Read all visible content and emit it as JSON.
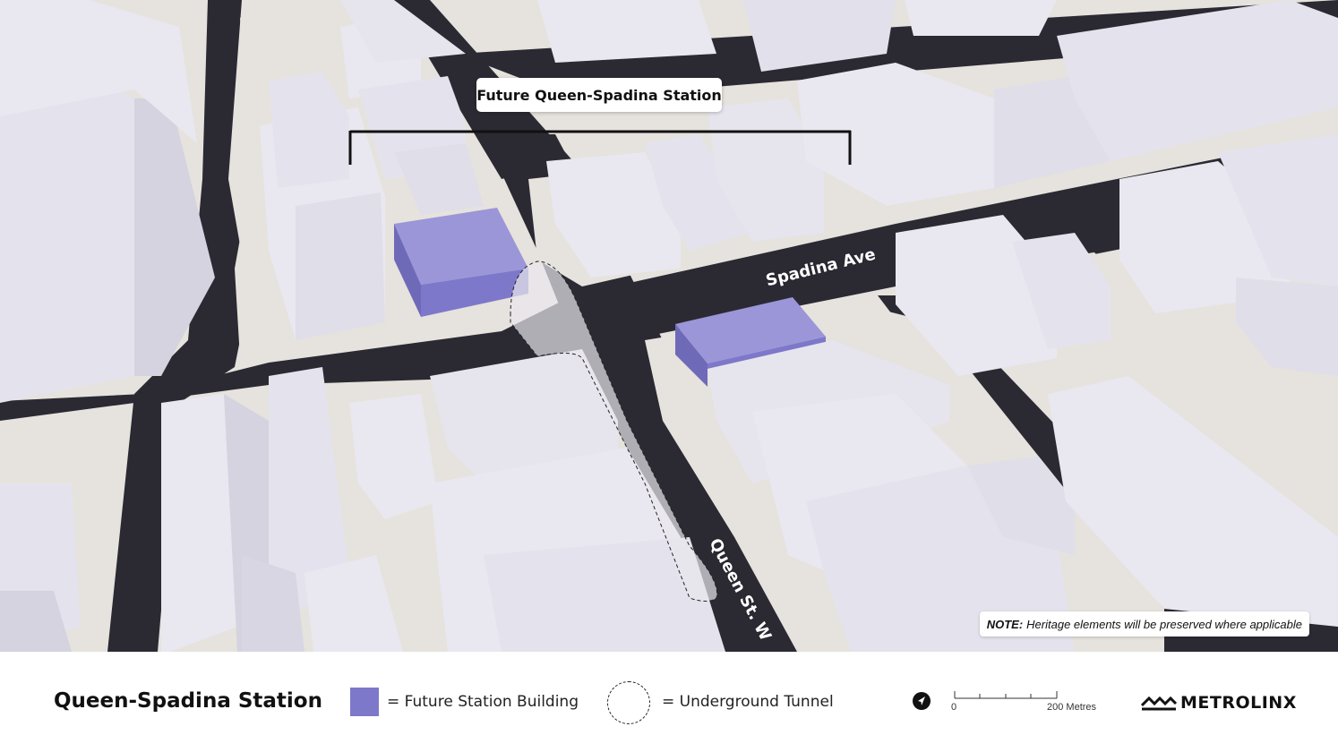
{
  "map": {
    "station_callout": "Future Queen-Spadina Station",
    "streets": {
      "spadina": "Spadina Ave",
      "queen": "Queen St. W"
    },
    "note": {
      "label": "NOTE:",
      "text": "Heritage elements will be preserved where applicable"
    },
    "colors": {
      "station_building": "#7d78c9",
      "road": "#2b2a33",
      "sidewalk": "#e6e2dd",
      "building_face": "#e7e6ef",
      "building_side": "#d4d3df",
      "park": "#5b7a2c"
    }
  },
  "legend": {
    "title": "Queen-Spadina Station",
    "station_building_label": "= Future Station Building",
    "tunnel_label": "= Underground Tunnel",
    "compass_icon": "north-arrow-icon",
    "scale": {
      "start": "0",
      "end": "200 Metres"
    },
    "brand": "METROLINX"
  }
}
